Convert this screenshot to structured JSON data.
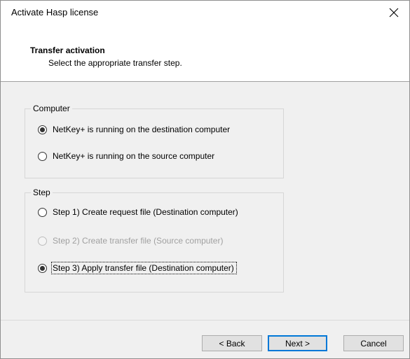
{
  "window": {
    "title": "Activate Hasp license"
  },
  "header": {
    "title": "Transfer activation",
    "subtitle": "Select the appropriate transfer step."
  },
  "computer_group": {
    "legend": "Computer",
    "options": [
      {
        "label": "NetKey+ is running on the destination computer",
        "checked": true,
        "enabled": true
      },
      {
        "label": "NetKey+ is running on the source computer",
        "checked": false,
        "enabled": true
      }
    ]
  },
  "step_group": {
    "legend": "Step",
    "options": [
      {
        "label": "Step 1) Create request file (Destination computer)",
        "checked": false,
        "enabled": true
      },
      {
        "label": "Step 2) Create transfer file (Source computer)",
        "checked": false,
        "enabled": false
      },
      {
        "label": "Step 3) Apply transfer file (Destination computer)",
        "checked": true,
        "enabled": true,
        "focused": true
      }
    ]
  },
  "buttons": {
    "back": "< Back",
    "next": "Next >",
    "cancel": "Cancel"
  },
  "colors": {
    "dialog_bg": "#f0f0f0",
    "header_bg": "#ffffff",
    "button_bg": "#e1e1e1",
    "default_button_border": "#0078d7",
    "disabled_text": "#a0a0a0"
  },
  "icons": {
    "close": "close-icon"
  }
}
